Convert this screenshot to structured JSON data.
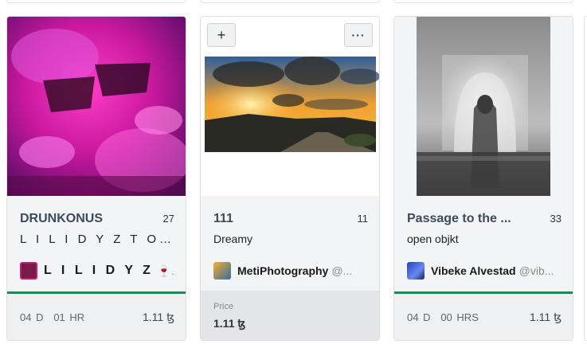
{
  "cards": [
    {
      "title": "DRUNKONUS",
      "edition": "27",
      "subtitle": "L I L I D Y Z T O P I ...",
      "artist_name": "L I L I D Y Z",
      "artist_handle": "🍷...",
      "timer": {
        "days": "04",
        "days_label": "D",
        "hours": "01",
        "hours_label": "HR"
      },
      "price": "1.11 ꜩ"
    },
    {
      "title": "111",
      "edition": "11",
      "subtitle": "Dreamy",
      "artist_name": "MetiPhotography",
      "artist_handle": "@...",
      "add_label": "+",
      "more_label": "···",
      "price_label": "Price",
      "price": "1.11 ꜩ"
    },
    {
      "title": "Passage to the ...",
      "edition": "33",
      "subtitle": "open objkt",
      "artist_name": "Vibeke Alvestad",
      "artist_handle": "@vib...",
      "timer": {
        "days": "04",
        "days_label": "D",
        "hours": "00",
        "hours_label": "HRS"
      },
      "price": "1.11 ꜩ"
    }
  ],
  "colors": {
    "accent_green": "#1f8a55",
    "card_bg": "#f3f4f5"
  },
  "icons": {
    "add": "plus-icon",
    "more": "ellipsis-icon"
  }
}
